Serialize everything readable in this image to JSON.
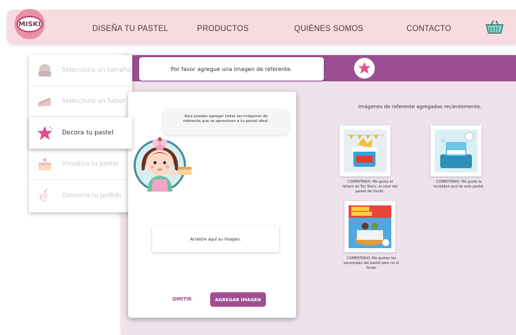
{
  "nav": {
    "logo_text": "MISKI",
    "items": [
      {
        "label": "DISEÑA TU PASTEL"
      },
      {
        "label": "PRODUCTOS"
      },
      {
        "label": "QUIÉNES SOMOS"
      },
      {
        "label": "CONTACTO"
      }
    ],
    "basket_icon": "basket-icon"
  },
  "steps": [
    {
      "label": "Selecciona un tamaño",
      "icon": "cake-size-icon",
      "state": "done"
    },
    {
      "label": "Selecciona un Sabor",
      "icon": "cake-slice-icon",
      "state": "done"
    },
    {
      "label": "Decora tu pastel",
      "icon": "star-icon",
      "state": "active"
    },
    {
      "label": "Visualiza tu pastel",
      "icon": "cake-view-icon",
      "state": "pending"
    },
    {
      "label": "Concreta tu pedido",
      "icon": "unicorn-icon",
      "state": "pending"
    }
  ],
  "instruction": "Por favor agregue una imagen de referente.",
  "upload": {
    "speech": "Aquí puedes agregar todas las imágenes de referente que se aproximen a tu pastel ideal.",
    "dropzone": "Arrastre aquí su imagen.",
    "omit_label": "OMITIR",
    "add_label": "AGREGAR IMAGEN"
  },
  "references": {
    "title": "Imágenes de referente agregadas recientemente.",
    "items": [
      {
        "comment": "COMENTARIO: Me gusta el letrero de Toy Story, el color del pastel del fondo."
      },
      {
        "comment": "COMENTARIO: Me gusta la tonalidad azul de este pastel."
      },
      {
        "comment": "COMENTARIO: Me gustan los personajes del pastel pero no el fondo"
      }
    ]
  },
  "colors": {
    "accent": "#9b4f92",
    "nav_bg": "#f7dbe0",
    "panel_bg": "#eee3ec"
  }
}
